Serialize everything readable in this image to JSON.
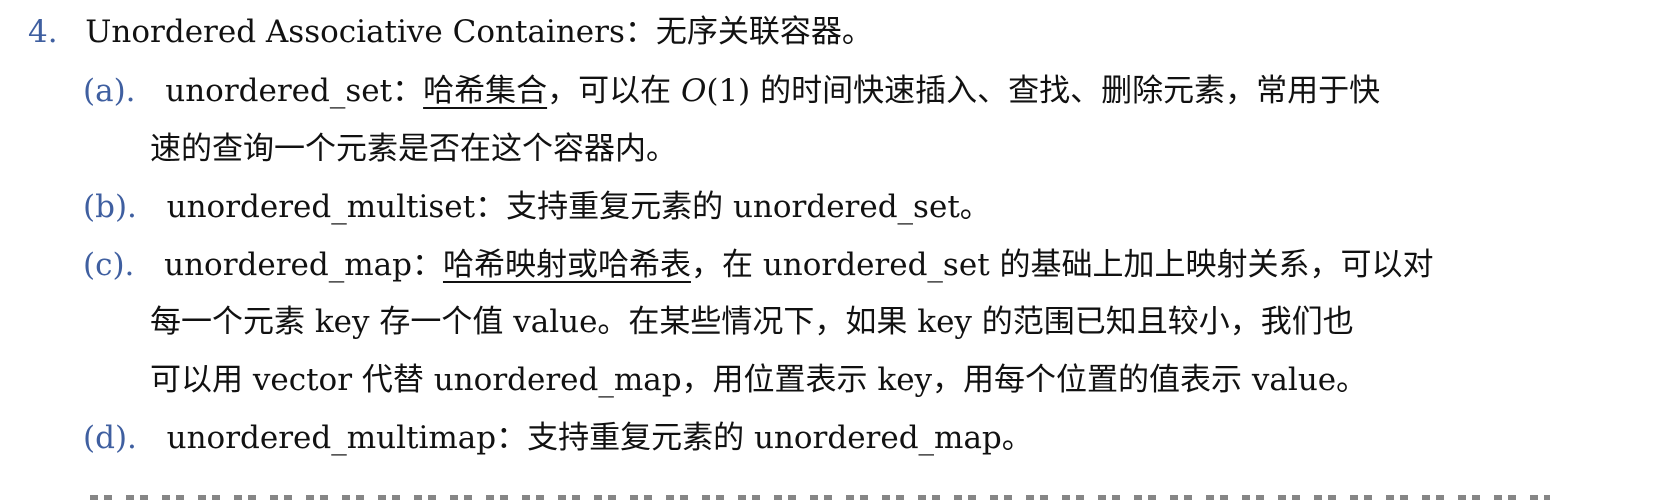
{
  "item4": {
    "number": "4.",
    "title": "Unordered Associative Containers",
    "desc": "：无序关联容器。"
  },
  "sub_a": {
    "label": "(a).",
    "term": "unordered_set",
    "colon": "：",
    "underlined": "哈希集合",
    "text1": "，可以在 ",
    "math_o": "O",
    "math_arg": "(1)",
    "text2": " 的时间快速插入、查找、删除元素，常用于快",
    "line2": "速的查询一个元素是否在这个容器内。"
  },
  "sub_b": {
    "label": "(b).",
    "term": "unordered_multiset",
    "text": "：支持重复元素的 unordered_set。"
  },
  "sub_c": {
    "label": "(c).",
    "term": "unordered_map",
    "colon": "：",
    "underlined": "哈希映射或哈希表",
    "text1": "，在 unordered_set 的基础上加上映射关系，可以对",
    "line2": "每一个元素 key 存一个值 value。在某些情况下，如果 key 的范围已知且较小，我们也",
    "line3": "可以用 vector 代替 unordered_map，用位置表示 key，用每个位置的值表示 value。"
  },
  "sub_d": {
    "label": "(d).",
    "term": "unordered_multimap",
    "text": "：支持重复元素的 unordered_map。"
  },
  "colors": {
    "label_blue": "#3f5fa0",
    "text": "#111111"
  }
}
